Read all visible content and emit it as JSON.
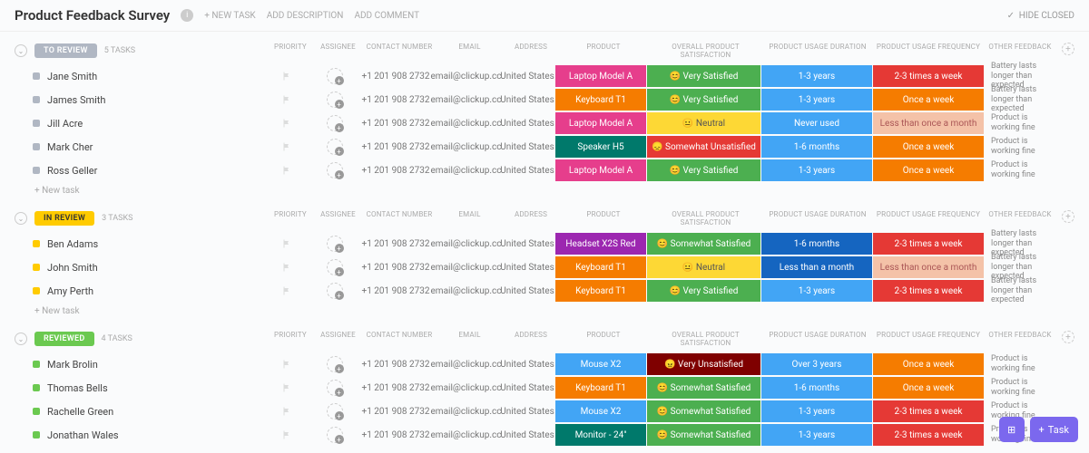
{
  "header": {
    "title": "Product Feedback Survey",
    "links": {
      "new_task": "+ NEW TASK",
      "add_desc": "ADD DESCRIPTION",
      "add_comment": "ADD COMMENT"
    },
    "hide_closed": "HIDE CLOSED"
  },
  "cols": {
    "priority": "PRIORITY",
    "assignee": "ASSIGNEE",
    "contact": "CONTACT NUMBER",
    "email": "EMAIL",
    "address": "ADDRESS",
    "product": "PRODUCT",
    "satisfaction": "OVERALL PRODUCT SATISFACTION",
    "duration": "PRODUCT USAGE DURATION",
    "frequency": "PRODUCT USAGE FREQUENCY",
    "feedback": "OTHER FEEDBACK"
  },
  "defaults": {
    "phone": "+1 201 908 2732",
    "email": "email@clickup.cc",
    "address": "United States"
  },
  "new_task_label": "+ New task",
  "groups": [
    {
      "status": "TO REVIEW",
      "status_class": "status-gray",
      "dot": "dot-gray",
      "count": "5 TASKS",
      "rows": [
        {
          "name": "Jane Smith",
          "product": "Laptop Model A",
          "p_bg": "bg-magenta",
          "sat": "😊 Very Satisfied",
          "s_bg": "bg-green",
          "dur": "1-3 years",
          "d_bg": "bg-blue",
          "freq": "2-3 times a week",
          "f_bg": "bg-red",
          "fb": "Battery lasts longer than expected"
        },
        {
          "name": "James Smith",
          "product": "Keyboard T1",
          "p_bg": "bg-orange",
          "sat": "😊 Very Satisfied",
          "s_bg": "bg-green",
          "dur": "1-3 years",
          "d_bg": "bg-blue",
          "freq": "Once a week",
          "f_bg": "bg-orange",
          "fb": "Battery lasts longer than expected"
        },
        {
          "name": "Jill Acre",
          "product": "Laptop Model A",
          "p_bg": "bg-magenta",
          "sat": "😐 Neutral",
          "s_bg": "bg-yellow",
          "dur": "Never used",
          "d_bg": "bg-blue",
          "freq": "Less than once a month",
          "f_bg": "bg-lightpeach",
          "fb": "Product is working fine"
        },
        {
          "name": "Mark Cher",
          "product": "Speaker H5",
          "p_bg": "bg-teal",
          "sat": "😞 Somewhat Unsatisfied",
          "s_bg": "bg-red",
          "dur": "1-6 months",
          "d_bg": "bg-blue",
          "freq": "Once a week",
          "f_bg": "bg-orange",
          "fb": "Product is working fine"
        },
        {
          "name": "Ross Geller",
          "product": "Laptop Model A",
          "p_bg": "bg-magenta",
          "sat": "😊 Very Satisfied",
          "s_bg": "bg-green",
          "dur": "1-3 years",
          "d_bg": "bg-blue",
          "freq": "Once a week",
          "f_bg": "bg-orange",
          "fb": "Product is working fine"
        }
      ]
    },
    {
      "status": "IN REVIEW",
      "status_class": "status-yellow",
      "dot": "dot-yellow",
      "count": "3 TASKS",
      "rows": [
        {
          "name": "Ben Adams",
          "product": "Headset X2S Red",
          "p_bg": "bg-purple",
          "sat": "😊 Somewhat Satisfied",
          "s_bg": "bg-green",
          "dur": "1-6 months",
          "d_bg": "bg-darkblue",
          "freq": "2-3 times a week",
          "f_bg": "bg-red",
          "fb": "Battery lasts longer than expected"
        },
        {
          "name": "John Smith",
          "product": "Keyboard T1",
          "p_bg": "bg-orange",
          "sat": "😐 Neutral",
          "s_bg": "bg-yellow",
          "dur": "Less than a month",
          "d_bg": "bg-darkblue",
          "freq": "Less than once a month",
          "f_bg": "bg-lightpeach",
          "fb": "Battery lasts longer than expected"
        },
        {
          "name": "Amy Perth",
          "product": "Keyboard T1",
          "p_bg": "bg-orange",
          "sat": "😊 Very Satisfied",
          "s_bg": "bg-green",
          "dur": "1-3 years",
          "d_bg": "bg-blue",
          "freq": "2-3 times a week",
          "f_bg": "bg-red",
          "fb": "Battery lasts longer than expected"
        }
      ]
    },
    {
      "status": "REVIEWED",
      "status_class": "status-green",
      "dot": "dot-green",
      "count": "4 TASKS",
      "rows": [
        {
          "name": "Mark Brolin",
          "product": "Mouse X2",
          "p_bg": "bg-blue",
          "sat": "😠 Very Unsatisfied",
          "s_bg": "bg-darkred",
          "dur": "Over 3 years",
          "d_bg": "bg-blue",
          "freq": "Once a week",
          "f_bg": "bg-orange",
          "fb": "Product is working fine"
        },
        {
          "name": "Thomas Bells",
          "product": "Keyboard T1",
          "p_bg": "bg-orange",
          "sat": "😊 Somewhat Satisfied",
          "s_bg": "bg-green",
          "dur": "1-6 months",
          "d_bg": "bg-blue",
          "freq": "Once a week",
          "f_bg": "bg-orange",
          "fb": "Product is working fine"
        },
        {
          "name": "Rachelle Green",
          "product": "Mouse X2",
          "p_bg": "bg-blue",
          "sat": "😊 Somewhat Satisfied",
          "s_bg": "bg-green",
          "dur": "1-3 years",
          "d_bg": "bg-blue",
          "freq": "2-3 times a week",
          "f_bg": "bg-red",
          "fb": "Product is working fine"
        },
        {
          "name": "Jonathan Wales",
          "product": "Monitor - 24\"",
          "p_bg": "bg-teal",
          "sat": "😊 Somewhat Satisfied",
          "s_bg": "bg-green",
          "dur": "1-3 years",
          "d_bg": "bg-blue",
          "freq": "2-3 times a week",
          "f_bg": "bg-red",
          "fb": "Product is working fine"
        }
      ]
    }
  ],
  "fab": {
    "task": "Task"
  }
}
